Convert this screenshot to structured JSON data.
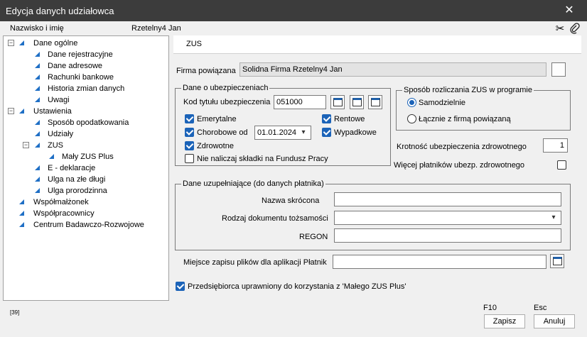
{
  "window": {
    "title": "Edycja danych udziałowca"
  },
  "header": {
    "name_label": "Nazwisko i imię",
    "name_value": "Rzetelny4 Jan"
  },
  "icons": {
    "close": "close-icon",
    "scissors": "scissors-icon",
    "paperclip": "paperclip-icon"
  },
  "tree": {
    "items": [
      {
        "label": "Dane ogólne",
        "level": 0,
        "expander": "−"
      },
      {
        "label": "Dane rejestracyjne",
        "level": 1
      },
      {
        "label": "Dane adresowe",
        "level": 1
      },
      {
        "label": "Rachunki bankowe",
        "level": 1
      },
      {
        "label": "Historia zmian danych",
        "level": 1
      },
      {
        "label": "Uwagi",
        "level": 1
      },
      {
        "label": "Ustawienia",
        "level": 0,
        "expander": "−"
      },
      {
        "label": "Sposób opodatkowania",
        "level": 1
      },
      {
        "label": "Udziały",
        "level": 1
      },
      {
        "label": "ZUS",
        "level": 1,
        "expander": "−"
      },
      {
        "label": "Mały ZUS Plus",
        "level": 2
      },
      {
        "label": "E - deklaracje",
        "level": 1
      },
      {
        "label": "Ulga na złe długi",
        "level": 1
      },
      {
        "label": "Ulga prorodzinna",
        "level": 1
      },
      {
        "label": "Współmałżonek",
        "level": 0
      },
      {
        "label": "Współpracownicy",
        "level": 0
      },
      {
        "label": "Centrum Badawczo-Rozwojowe",
        "level": 0
      }
    ]
  },
  "tab": {
    "label": "ZUS"
  },
  "firma": {
    "label": "Firma powiązana",
    "value": "Solidna Firma Rzetelny4 Jan"
  },
  "ubezpieczenia": {
    "legend": "Dane o ubezpieczeniach",
    "kod_label": "Kod tytułu ubezpieczenia",
    "kod_value": "051000",
    "emerytalne": "Emerytalne",
    "rentowe": "Rentowe",
    "chorobowe": "Chorobowe od",
    "chorobowe_date": "01.01.2024",
    "wypadkowe": "Wypadkowe",
    "zdrowotne": "Zdrowotne",
    "nie_naliczaj": "Nie naliczaj składki na Fundusz Pracy"
  },
  "sposob": {
    "legend": "Sposób rozliczania ZUS w programie",
    "samodzielnie": "Samodzielnie",
    "lacznie": "Łącznie z firmą powiązaną"
  },
  "krotnosc": {
    "label": "Krotność ubezpieczenia zdrowotnego",
    "value": "1"
  },
  "wiecej": {
    "label": "Więcej płatników ubezp. zdrowotnego"
  },
  "uzupelniajace": {
    "legend": "Dane uzupełniające (do danych płatnika)",
    "nazwa_label": "Nazwa skrócona",
    "nazwa_value": "",
    "rodzaj_label": "Rodzaj dokumentu tożsamości",
    "rodzaj_value": "",
    "regon_label": "REGON",
    "regon_value": ""
  },
  "miejsce": {
    "label": "Miejsce zapisu plików dla aplikacji Płatnik",
    "value": ""
  },
  "przedsiebiorca": {
    "label": "Przedsiębiorca uprawniony do korzystania z 'Małego ZUS Plus'"
  },
  "footer": {
    "code": "[39]",
    "save_key": "F10",
    "cancel_key": "Esc",
    "save_label": "Zapisz",
    "cancel_label": "Anuluj"
  },
  "colors": {
    "accent": "#1b63b8",
    "titlebar": "#3c3c3c"
  }
}
